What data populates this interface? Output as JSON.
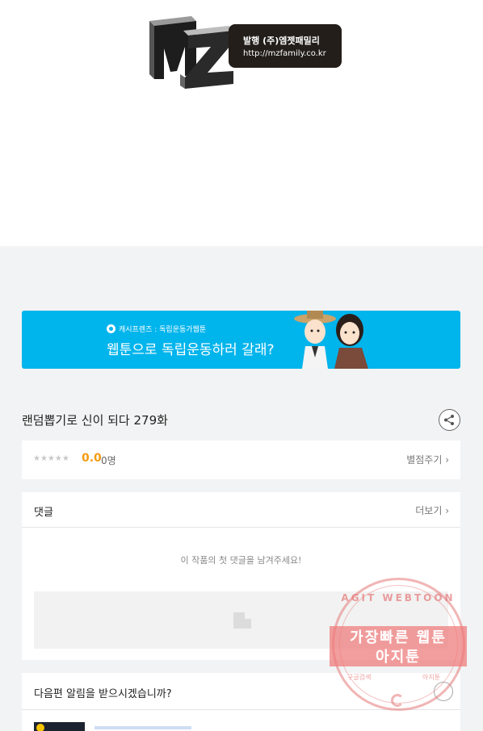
{
  "publisher": {
    "logo_letters": "MZ",
    "line1": "발행 (주)엠젯패밀리",
    "line2": "http://mzfamily.co.kr"
  },
  "banner": {
    "small_label": "캐시프렌즈 : 독립운동가웹툰",
    "headline": "웹툰으로 독립운동하러 갈래?"
  },
  "episode": {
    "title": "랜덤뽑기로 신이 되다 279화"
  },
  "rating": {
    "stars": "★★★★★",
    "score": "0.0",
    "count": "0명",
    "rate_link": "별점주기 ›"
  },
  "comments": {
    "title": "댓글",
    "more": "더보기 ›",
    "empty_message": "이 작품의 첫 댓글을 남겨주세요!"
  },
  "notify": {
    "title": "다음편 알림을 받으시겠습니까?"
  },
  "watermark": {
    "top": "AGIT WEBTOON",
    "line1": "가장빠른 웹툰",
    "line2": "아지툰",
    "left": "구글검색",
    "right": "아지툰"
  },
  "colors": {
    "banner_bg": "#00b4ec",
    "score": "#f39c12",
    "stamp": "#ee7878"
  }
}
